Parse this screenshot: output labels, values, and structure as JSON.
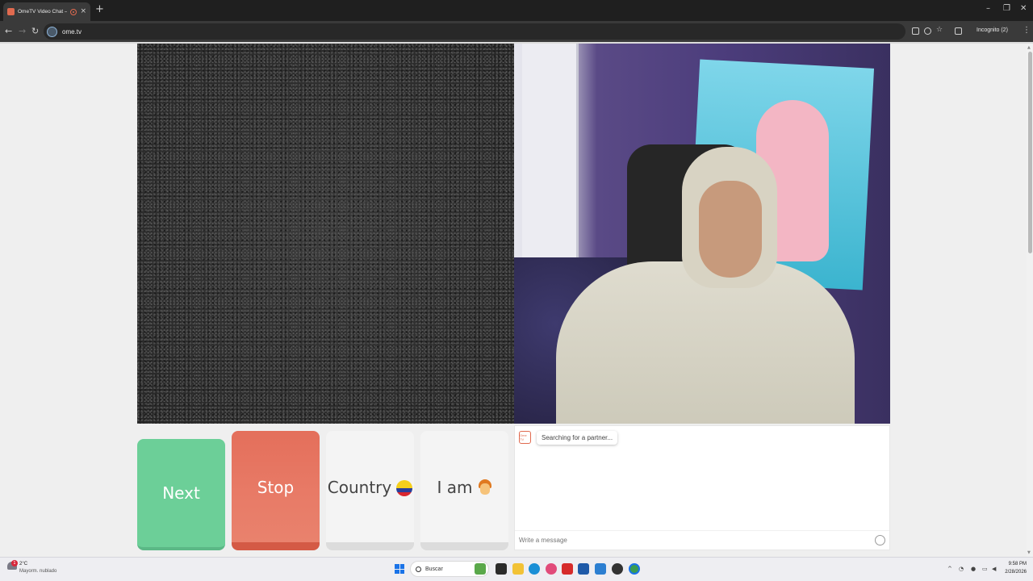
{
  "browser": {
    "tab_title": "OmeTV Video Chat — Ome",
    "tab_close": "×",
    "new_tab": "+",
    "url": "ome.tv",
    "incognito_label": "Incognito (2)",
    "window_controls": {
      "minimize": "–",
      "restore": "❐",
      "close": "✕"
    },
    "nav": {
      "back": "←",
      "forward": "→",
      "reload": "↻"
    },
    "menu": "⋮"
  },
  "buttons": {
    "next": "Next",
    "stop": "Stop",
    "country": "Country",
    "iam": "I am"
  },
  "chat": {
    "logo": "Ome TV",
    "status_message": "Searching for a partner...",
    "input_placeholder": "Write a message"
  },
  "taskbar": {
    "weather_badge": "1",
    "weather_temp": "2°C",
    "weather_desc": "Mayorm. nublado",
    "search_label": "Buscar",
    "time": "9:58 PM",
    "date": "2/28/2026"
  },
  "colors": {
    "next_button": "#6ccf98",
    "stop_button": "#e46f5b",
    "neutral_button": "#f4f4f4",
    "brand": "#e06a4f"
  },
  "icons": {
    "country_flag": "colombia-flag-icon",
    "iam_avatar": "boy-emoji-icon"
  }
}
